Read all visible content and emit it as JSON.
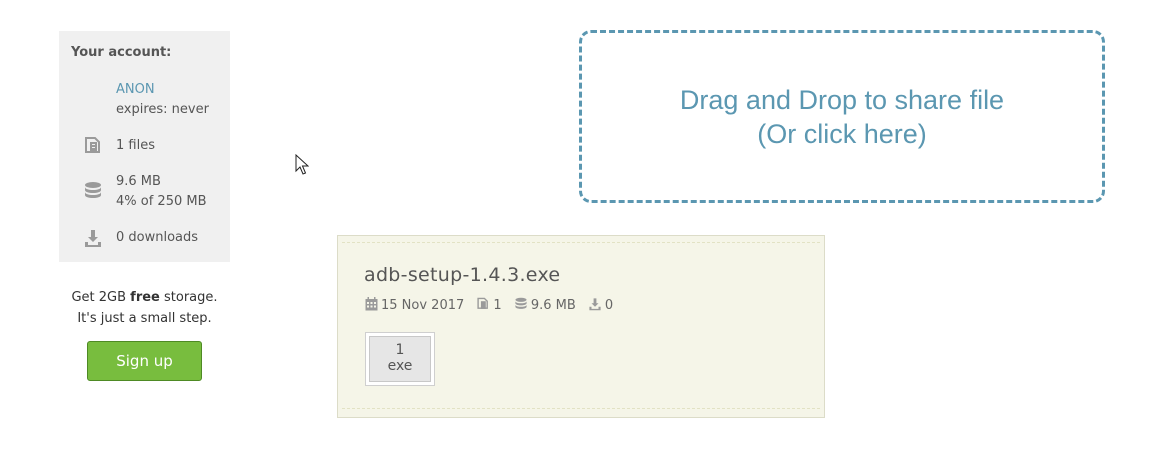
{
  "account": {
    "heading": "Your account:",
    "name": "ANON",
    "expires": "expires: never",
    "files": "1 files",
    "storage_size": "9.6 MB",
    "storage_percent": "4% of 250 MB",
    "downloads": "0 downloads",
    "icons": [
      "files-icon",
      "database-icon",
      "download-icon"
    ]
  },
  "promo": {
    "line1_prefix": "Get 2GB ",
    "line1_bold": "free",
    "line1_suffix": " storage.",
    "line2": "It's just a small step.",
    "signup_label": "Sign up"
  },
  "dropzone": {
    "line1": "Drag and Drop to share file",
    "line2": "(Or click here)",
    "color": "#5b97b1"
  },
  "file": {
    "name": "adb-setup-1.4.3.exe",
    "date": "15 Nov 2017",
    "count": "1",
    "size": "9.6 MB",
    "downloads": "0",
    "thumb_count": "1",
    "thumb_ext": "exe",
    "icons": [
      "calendar-icon",
      "files-icon",
      "database-icon",
      "download-icon"
    ]
  },
  "colors": {
    "accent": "#5b97b1",
    "signup_green": "#78bd3e",
    "card_bg": "#f5f5e8",
    "panel_bg": "#f0f0f0"
  }
}
